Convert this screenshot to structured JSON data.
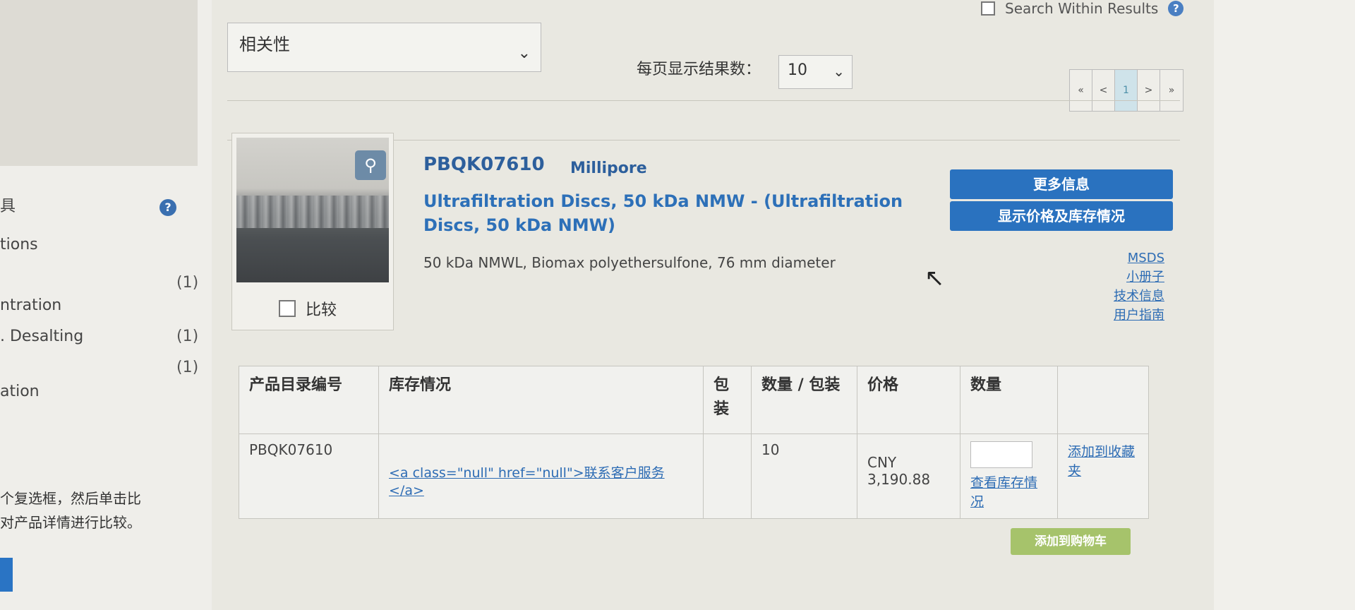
{
  "sidebar": {
    "facets": [
      {
        "label": "具",
        "count": ""
      },
      {
        "label": "tions",
        "count": ""
      },
      {
        "label": "",
        "count": "(1)"
      },
      {
        "label": "ntration",
        "count": ""
      },
      {
        "label": ". Desalting",
        "count": "(1)"
      },
      {
        "label": "",
        "count": "(1)"
      },
      {
        "label": "ation",
        "count": ""
      }
    ],
    "note_line1": "个复选框，然后单击比",
    "note_line2": "对产品详情进行比较。"
  },
  "header": {
    "search_within_label": "Search Within Results",
    "help_icon": "?"
  },
  "toolbar": {
    "sort_value": "相关性",
    "per_page_label": "每页显示结果数：",
    "per_page_value": "10",
    "pager": [
      "«",
      "<",
      "1",
      ">",
      "»"
    ]
  },
  "product": {
    "compare_label": "比较",
    "sku": "PBQK07610",
    "brand": "Millipore",
    "title": "Ultrafiltration Discs, 50 kDa NMW - (Ultrafiltration Discs, 50 kDa NMW)",
    "description": "50 kDa NMWL, Biomax polyethersulfone, 76 mm diameter",
    "more_info_button": "更多信息",
    "price_stock_button": "显示价格及库存情况",
    "links": [
      "MSDS",
      "小册子",
      "技术信息",
      "用户指南"
    ]
  },
  "table": {
    "headers": [
      "产品目录编号",
      "库存情况",
      "包装",
      "数量 / 包装",
      "价格",
      "数量",
      ""
    ],
    "row": {
      "catalog": "PBQK07610",
      "stock_link": "<a class=\"null\" href=\"null\">联系客户服务</a>",
      "pack": "",
      "qty_per_pack": "10",
      "price_currency": "CNY",
      "price_value": "3,190.88",
      "check_stock_link": "查看库存情况",
      "add_favorites_link": "添加到收藏夹"
    },
    "add_to_cart_button": "添加到购物车"
  }
}
